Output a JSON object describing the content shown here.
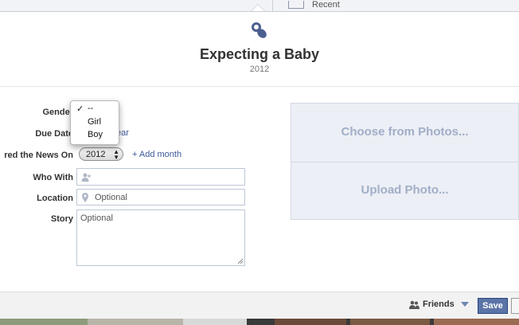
{
  "topbar": {
    "recent_label": "Recent"
  },
  "event": {
    "title": "Expecting a Baby",
    "year": "2012",
    "icon": "pacifier-icon"
  },
  "form": {
    "gender_label": "Gender",
    "due_date_label": "Due Date",
    "due_date_link": "ear",
    "shared_label": "red the News On",
    "shared_year": "2012",
    "add_month": "+ Add month",
    "who_with_label": "Who With",
    "location_label": "Location",
    "location_placeholder": "Optional",
    "story_label": "Story",
    "story_placeholder": "Optional"
  },
  "gender_dropdown": {
    "options": [
      "--",
      "Girl",
      "Boy"
    ],
    "selected": "--"
  },
  "photos": {
    "choose_label": "Choose from Photos...",
    "upload_label": "Upload Photo..."
  },
  "footer": {
    "audience_label": "Friends",
    "save_label": "Save"
  },
  "colors": {
    "accent": "#3b5998",
    "save_button": "#5b74a8",
    "photos_panel": "#eceff5",
    "photos_text": "#a1aec8"
  }
}
